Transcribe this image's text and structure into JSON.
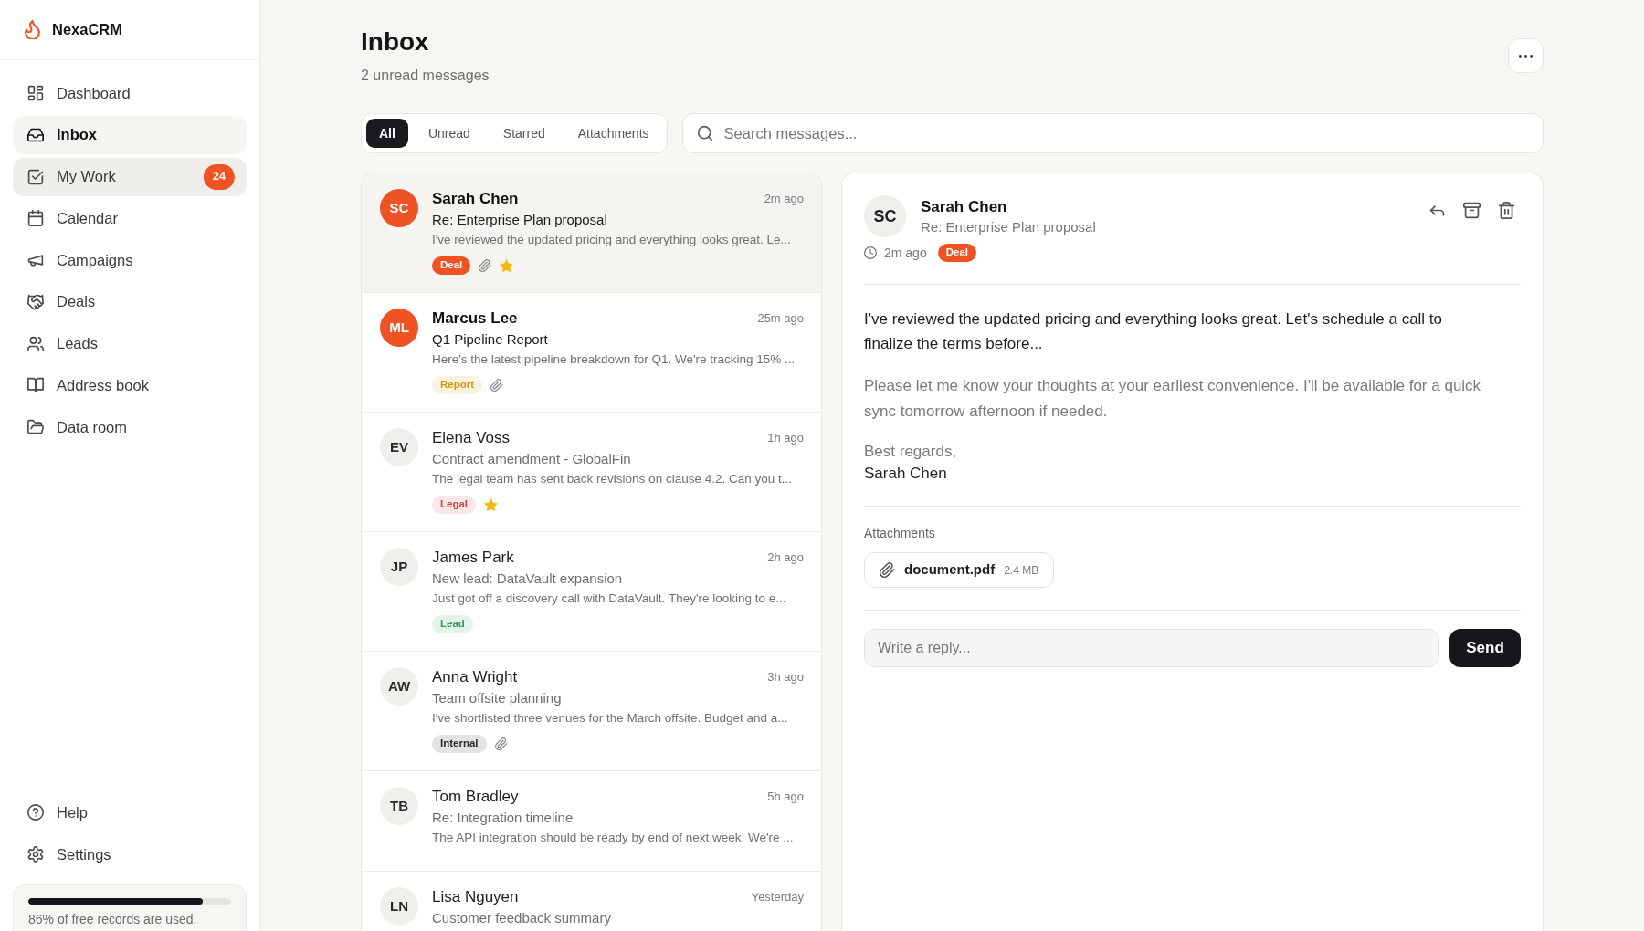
{
  "sidebar": {
    "brand": "NexaCRM",
    "items": [
      {
        "label": "Dashboard",
        "selected": false,
        "hovered": false
      },
      {
        "label": "Inbox",
        "selected": true,
        "hovered": false
      },
      {
        "label": "My Work",
        "selected": false,
        "hovered": true,
        "badge": "24"
      },
      {
        "label": "Calendar",
        "selected": false,
        "hovered": false
      },
      {
        "label": "Campaigns",
        "selected": false,
        "hovered": false
      },
      {
        "label": "Deals",
        "selected": false,
        "hovered": false
      },
      {
        "label": "Leads",
        "selected": false,
        "hovered": false
      },
      {
        "label": "Address book",
        "selected": false,
        "hovered": false
      },
      {
        "label": "Data room",
        "selected": false,
        "hovered": false
      }
    ],
    "footer_items": [
      {
        "label": "Help",
        "selected": false
      },
      {
        "label": "Settings",
        "selected": false
      }
    ],
    "usage": {
      "level": 0.86,
      "text": "86% of free records are used."
    }
  },
  "header": {
    "title": "Inbox",
    "subtitle": "2 unread messages"
  },
  "filters": [
    {
      "label": "All",
      "selected": true
    },
    {
      "label": "Unread",
      "selected": false
    },
    {
      "label": "Starred",
      "selected": false
    },
    {
      "label": "Attachments",
      "selected": false
    }
  ],
  "search": {
    "placeholder": "Search messages..."
  },
  "messages": [
    {
      "initials": "SC",
      "name": "Sarah Chen",
      "time": "2m ago",
      "subject": "Re: Enterprise Plan proposal",
      "preview": "I've reviewed the updated pricing and everything looks great. Le...",
      "unread": true,
      "selected": true,
      "tags": [
        {
          "label": "Deal",
          "kind": "solid",
          "color": "#ef5323"
        }
      ],
      "attachment": true,
      "starred": true
    },
    {
      "initials": "ML",
      "name": "Marcus Lee",
      "time": "25m ago",
      "subject": "Q1 Pipeline Report",
      "preview": "Here's the latest pipeline breakdown for Q1. We're tracking 15% ...",
      "unread": true,
      "selected": false,
      "tags": [
        {
          "label": "Report",
          "kind": "soft",
          "color": "#d19a0c"
        }
      ],
      "attachment": true,
      "starred": false
    },
    {
      "initials": "EV",
      "name": "Elena Voss",
      "time": "1h ago",
      "subject": "Contract amendment - GlobalFin",
      "preview": "The legal team has sent back revisions on clause 4.2. Can you t...",
      "unread": false,
      "selected": false,
      "tags": [
        {
          "label": "Legal",
          "kind": "soft",
          "color": "#d23f3f"
        }
      ],
      "attachment": false,
      "starred": true
    },
    {
      "initials": "JP",
      "name": "James Park",
      "time": "2h ago",
      "subject": "New lead: DataVault expansion",
      "preview": "Just got off a discovery call with DataVault. They're looking to e...",
      "unread": false,
      "selected": false,
      "tags": [
        {
          "label": "Lead",
          "kind": "soft",
          "color": "#2f9f5b"
        }
      ],
      "attachment": false,
      "starred": false
    },
    {
      "initials": "AW",
      "name": "Anna Wright",
      "time": "3h ago",
      "subject": "Team offsite planning",
      "preview": "I've shortlisted three venues for the March offsite. Budget and a...",
      "unread": false,
      "selected": false,
      "tags": [
        {
          "label": "Internal",
          "kind": "soft",
          "color": "#2a2a2a"
        }
      ],
      "attachment": true,
      "starred": false
    },
    {
      "initials": "TB",
      "name": "Tom Bradley",
      "time": "5h ago",
      "subject": "Re: Integration timeline",
      "preview": "The API integration should be ready by end of next week. We're ...",
      "unread": false,
      "selected": false,
      "attachment": false,
      "starred": false
    },
    {
      "initials": "LN",
      "name": "Lisa Nguyen",
      "time": "Yesterday",
      "subject": "Customer feedback summary",
      "unread": false,
      "selected": false,
      "attachment": false,
      "starred": false
    }
  ],
  "detail": {
    "initials": "SC",
    "name": "Sarah Chen",
    "subject": "Re: Enterprise Plan proposal",
    "time": "2m ago",
    "tags": [
      {
        "label": "Deal",
        "kind": "solid",
        "color": "#ef5323"
      }
    ],
    "body": [
      {
        "kind": "primary",
        "text": "I've reviewed the updated pricing and everything looks great. Let's schedule a call to finalize the terms before..."
      },
      {
        "kind": "secondary",
        "text": "Please let me know your thoughts at your earliest convenience. I'll be available for a quick sync tomorrow afternoon if needed."
      }
    ],
    "closing": "Best regards,",
    "signature": "Sarah Chen",
    "attachments_title": "Attachments",
    "attachments": [
      {
        "name": "document.pdf",
        "size": "2.4 MB"
      }
    ],
    "reply": {
      "placeholder": "Write a reply..."
    },
    "send_button": "Send"
  }
}
